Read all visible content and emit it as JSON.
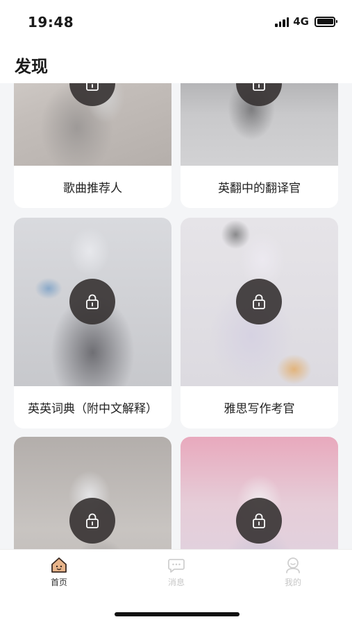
{
  "status_bar": {
    "time": "19:48",
    "network": "4G",
    "icons": [
      "signal-icon",
      "battery-icon"
    ]
  },
  "header": {
    "title": "发现"
  },
  "cards": [
    {
      "label": "歌曲推荐人",
      "locked": true,
      "icon": "lock-icon"
    },
    {
      "label": "英翻中的翻译官",
      "locked": true,
      "icon": "lock-icon"
    },
    {
      "label": "英英词典（附中文解释）",
      "locked": true,
      "icon": "lock-icon"
    },
    {
      "label": "雅思写作考官",
      "locked": true,
      "icon": "lock-icon"
    },
    {
      "label": "",
      "locked": true,
      "icon": "lock-icon"
    },
    {
      "label": "",
      "locked": true,
      "icon": "lock-icon"
    }
  ],
  "tab_bar": {
    "tabs": [
      {
        "label": "首页",
        "icon": "home-icon",
        "active": true
      },
      {
        "label": "消息",
        "icon": "message-icon",
        "active": false
      },
      {
        "label": "我的",
        "icon": "profile-icon",
        "active": false
      }
    ]
  },
  "colors": {
    "accent_home": "#e8b48a",
    "lock_badge": "#363232",
    "inactive_tab": "#c7c7c7",
    "page_background": "#f4f5f7"
  }
}
